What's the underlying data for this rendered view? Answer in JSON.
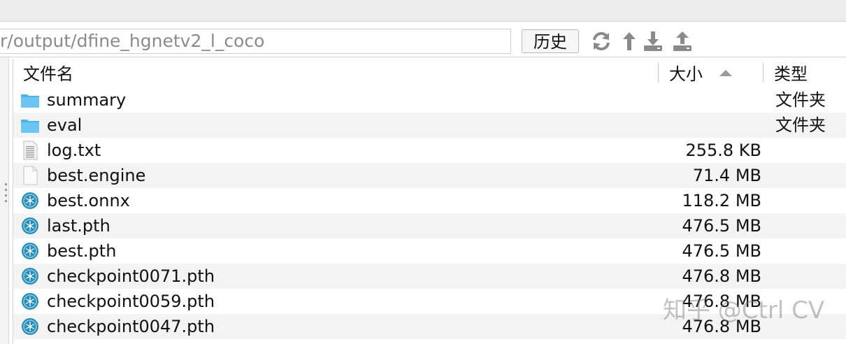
{
  "path_bar": {
    "path_value": "r/output/dfine_hgnetv2_l_coco",
    "history_button": "历史"
  },
  "toolbar": {
    "icons": [
      "refresh-icon",
      "upload-arrow-icon",
      "download-icon",
      "upload-icon"
    ]
  },
  "table": {
    "columns": {
      "name": "文件名",
      "size": "大小",
      "type": "类型"
    },
    "sort": {
      "column": "size",
      "direction": "ascending"
    },
    "rows": [
      {
        "name": "summary",
        "size": "",
        "type": "文件夹",
        "icon": "folder-icon"
      },
      {
        "name": "eval",
        "size": "",
        "type": "文件夹",
        "icon": "folder-icon"
      },
      {
        "name": "log.txt",
        "size": "255.8 KB",
        "type": "",
        "icon": "text-file-icon"
      },
      {
        "name": "best.engine",
        "size": "71.4 MB",
        "type": "",
        "icon": "blank-file-icon"
      },
      {
        "name": "best.onnx",
        "size": "118.2 MB",
        "type": "",
        "icon": "model-file-icon"
      },
      {
        "name": "last.pth",
        "size": "476.5 MB",
        "type": "",
        "icon": "model-file-icon"
      },
      {
        "name": "best.pth",
        "size": "476.5 MB",
        "type": "",
        "icon": "model-file-icon"
      },
      {
        "name": "checkpoint0071.pth",
        "size": "476.8 MB",
        "type": "",
        "icon": "model-file-icon"
      },
      {
        "name": "checkpoint0059.pth",
        "size": "476.8 MB",
        "type": "",
        "icon": "model-file-icon"
      },
      {
        "name": "checkpoint0047.pth",
        "size": "476.8 MB",
        "type": "",
        "icon": "model-file-icon"
      }
    ]
  },
  "watermark": "知乎 @Ctrl CV",
  "colors": {
    "folder": "#4fb3e8",
    "model_icon": "#2a8fb8",
    "row_alt": "#f3f3f3"
  }
}
